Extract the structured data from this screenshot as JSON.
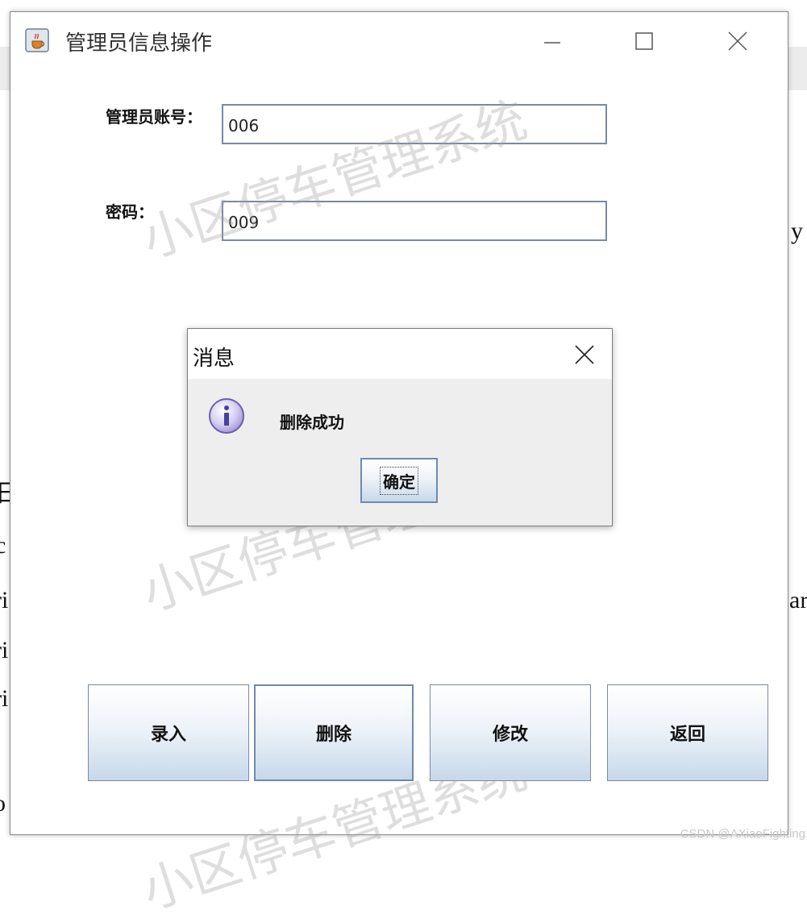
{
  "window": {
    "title": "管理员信息操作",
    "icon": "java-cup-icon"
  },
  "form": {
    "account_label": "管理员账号：",
    "account_value": "006",
    "password_label": "密码：",
    "password_value": "009"
  },
  "buttons": {
    "enter": "录入",
    "delete": "删除",
    "modify": "修改",
    "back": "返回"
  },
  "dialog": {
    "title": "消息",
    "message": "删除成功",
    "ok_label": "确定",
    "icon": "info-icon"
  },
  "watermark": "小区停车管理系统",
  "credit": "CSDN @AXiaoFighting",
  "background_text": [
    "日",
    "c",
    "ri",
    "ri",
    "ri",
    "o",
    "y",
    "ar"
  ]
}
